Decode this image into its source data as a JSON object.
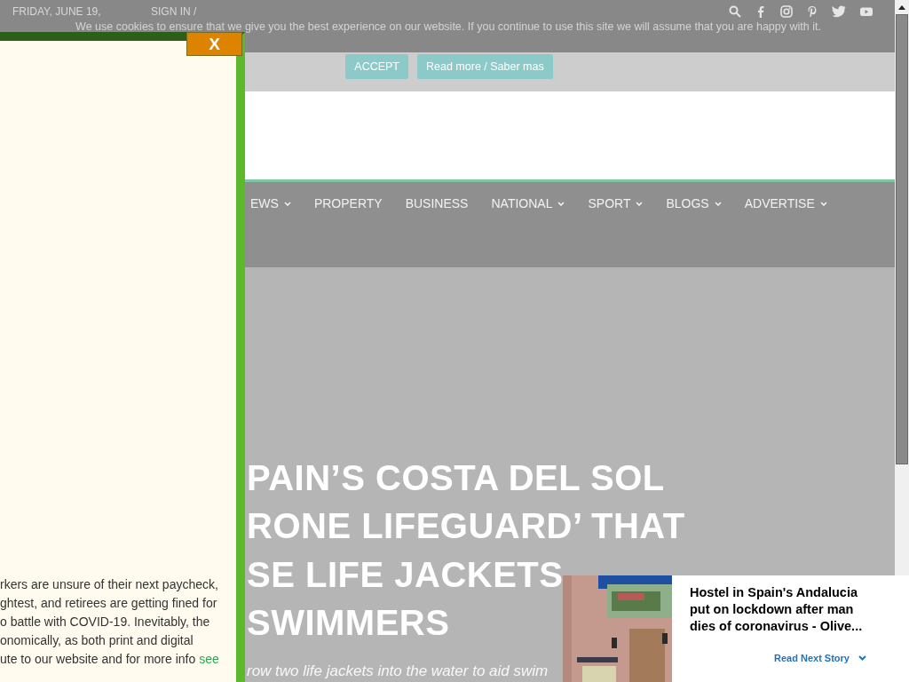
{
  "top_bar": {
    "date": "FRIDAY, JUNE 19,",
    "sign_in": "SIGN IN /"
  },
  "cookie_notice": {
    "message": "We use cookies to ensure that we give you the best experience on our website. If you continue to use this site we will assume that you are happy with it.",
    "buttons": [
      "ACCEPT",
      "Read more / Saber mas"
    ]
  },
  "nav": {
    "items": [
      {
        "label": "EWS",
        "dropdown": true
      },
      {
        "label": "PROPERTY",
        "dropdown": false
      },
      {
        "label": "BUSINESS",
        "dropdown": false
      },
      {
        "label": "NATIONAL",
        "dropdown": true
      },
      {
        "label": "SPORT",
        "dropdown": true
      },
      {
        "label": "BLOGS",
        "dropdown": true
      },
      {
        "label": "ADVERTISE",
        "dropdown": true
      }
    ]
  },
  "article": {
    "headline_lines": [
      "PAIN’S COSTA DEL SOL",
      "RONE LIFEGUARD’ THAT",
      "SE LIFE JACKETS",
      "SWIMMERS"
    ],
    "subtitle": "row two life jackets into the water to aid swim"
  },
  "popup": {
    "close": "X",
    "lines": [
      "rkers are unsure of their next paycheck,",
      "ghtest, and retirees are getting fined for",
      "o battle with COVID-19. Inevitably, the",
      "onomically, as both print and digital",
      "ute to our website and for more info"
    ],
    "link": "see"
  },
  "next_story": {
    "title": "Hostel in Spain's Andalucia put on lockdown after man dies of coronavirus - Olive...",
    "action": "Read Next Story"
  }
}
